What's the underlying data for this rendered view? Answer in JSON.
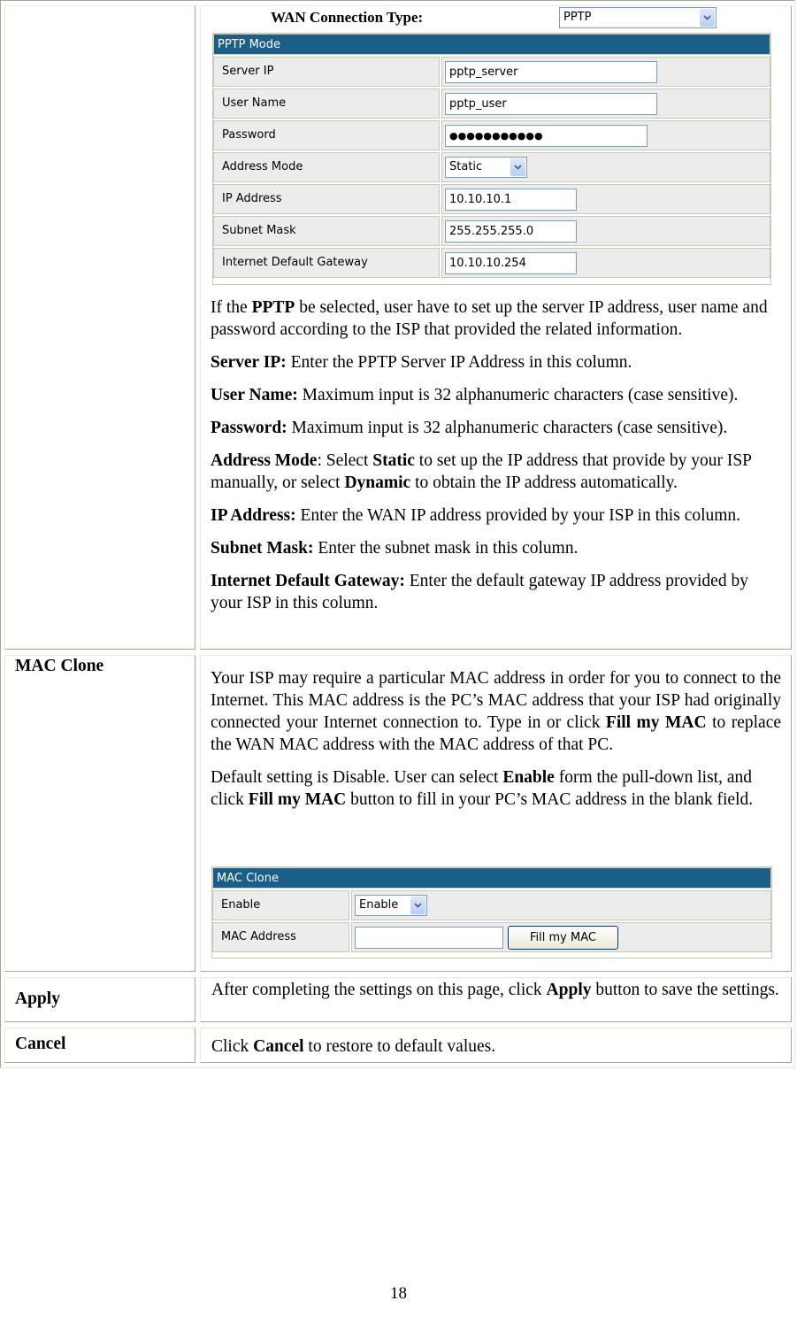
{
  "pptp_section": {
    "wan_connection_type_label": "WAN Connection Type:",
    "wan_connection_type_value": "PPTP",
    "panel_title": "PPTP Mode",
    "fields": [
      {
        "label": "Server IP",
        "value": "pptp_server",
        "type": "text"
      },
      {
        "label": "User Name",
        "value": "pptp_user",
        "type": "text"
      },
      {
        "label": "Password",
        "value": "●●●●●●●●●●●",
        "type": "password"
      },
      {
        "label": "Address Mode",
        "value": "Static",
        "type": "select"
      },
      {
        "label": "IP Address",
        "value": "10.10.10.1",
        "type": "text"
      },
      {
        "label": "Subnet Mask",
        "value": "255.255.255.0",
        "type": "text"
      },
      {
        "label": "Internet Default Gateway",
        "value": "10.10.10.254",
        "type": "text"
      }
    ],
    "descriptions": {
      "intro_pre": "If the ",
      "intro_bold": "PPTP",
      "intro_post": " be selected, user have to set up the server IP address, user name and password according to the ISP that provided the related information.",
      "server_ip_term": "Server IP:",
      "server_ip_text": " Enter the PPTP Server IP Address in this column.",
      "user_name_term": "User Name:",
      "user_name_text": " Maximum input is 32 alphanumeric characters (case sensitive).",
      "password_term": "Password:",
      "password_text": " Maximum input is 32 alphanumeric characters (case sensitive).",
      "address_mode_term": "Address Mode",
      "address_mode_text1": ": Select ",
      "address_mode_static": "Static",
      "address_mode_text2": " to set up the IP address that provide by your ISP manually, or select ",
      "address_mode_dynamic": "Dynamic",
      "address_mode_text3": " to obtain the IP address automatically.",
      "ip_address_term": "IP Address:",
      "ip_address_text": " Enter the WAN IP address provided by your ISP in this column.",
      "subnet_mask_term": "Subnet Mask:",
      "subnet_mask_text": " Enter the subnet mask in this column.",
      "gateway_term": "Internet Default Gateway:",
      "gateway_text": " Enter the default gateway IP address provided by your ISP in this column."
    }
  },
  "mac_clone_section": {
    "label": "MAC Clone",
    "para1_pre": "Your ISP may require a particular MAC address in order for you to connect to the Internet. This MAC address is the PC’s MAC address that your ISP had originally connected your Internet connection to. Type in or click ",
    "para1_bold": "Fill my MAC",
    "para1_post": " to replace the WAN MAC address with the MAC address of that PC.",
    "para2_pre": "Default setting is Disable. User can select ",
    "para2_bold1": "Enable",
    "para2_mid": " form the pull-down list, and click ",
    "para2_bold2": "Fill my MAC",
    "para2_post": " button to fill in your PC’s MAC address in the blank field.",
    "panel_title": "MAC Clone",
    "enable_label": "Enable",
    "enable_value": "Enable",
    "mac_address_label": "MAC Address",
    "mac_address_value": "",
    "fill_button": "Fill my MAC"
  },
  "apply_section": {
    "label": "Apply",
    "text_pre": "After completing the settings on this page, click ",
    "text_bold": "Apply",
    "text_post": " button to save the settings."
  },
  "cancel_section": {
    "label": "Cancel",
    "text_pre": "Click ",
    "text_bold": "Cancel",
    "text_post": " to restore to default values."
  },
  "footer": {
    "page_number": "18"
  },
  "colors": {
    "panel_header_bg": "#1b5e86",
    "row_bg": "#ececec"
  }
}
